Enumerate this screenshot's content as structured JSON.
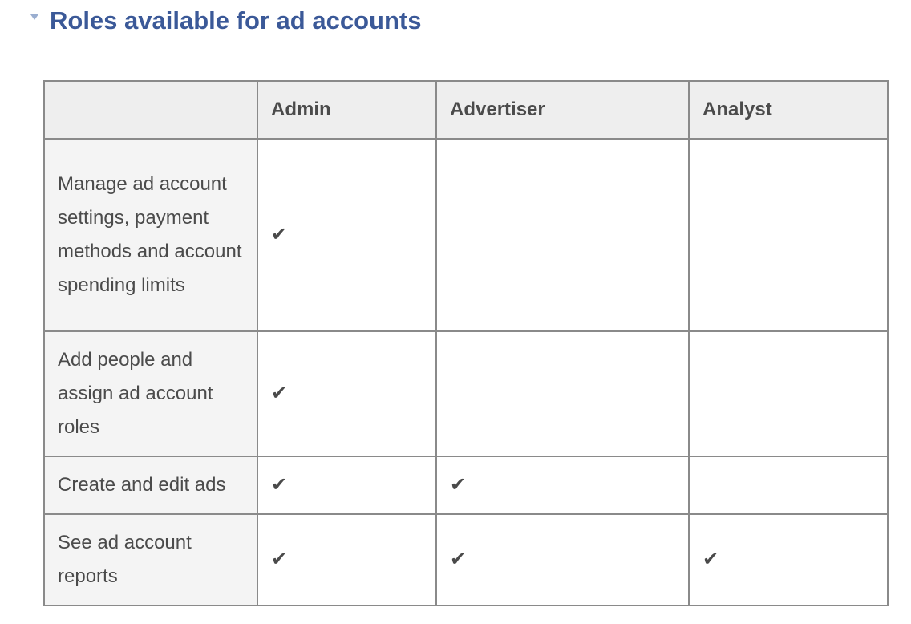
{
  "section": {
    "title": "Roles available for ad accounts",
    "collapse_icon": "triangle-down-icon"
  },
  "table": {
    "headers": [
      "",
      "Admin",
      "Advertiser",
      "Analyst"
    ],
    "check_glyph": "✔",
    "rows": [
      {
        "permission": "Manage ad account settings, payment methods and account spending limits",
        "admin": "✔",
        "advertiser": "",
        "analyst": ""
      },
      {
        "permission": "Add people and assign ad account roles",
        "admin": "✔",
        "advertiser": "",
        "analyst": ""
      },
      {
        "permission": "Create and edit ads",
        "admin": "✔",
        "advertiser": "✔",
        "analyst": ""
      },
      {
        "permission": "See ad account reports",
        "admin": "✔",
        "advertiser": "✔",
        "analyst": "✔"
      }
    ]
  }
}
